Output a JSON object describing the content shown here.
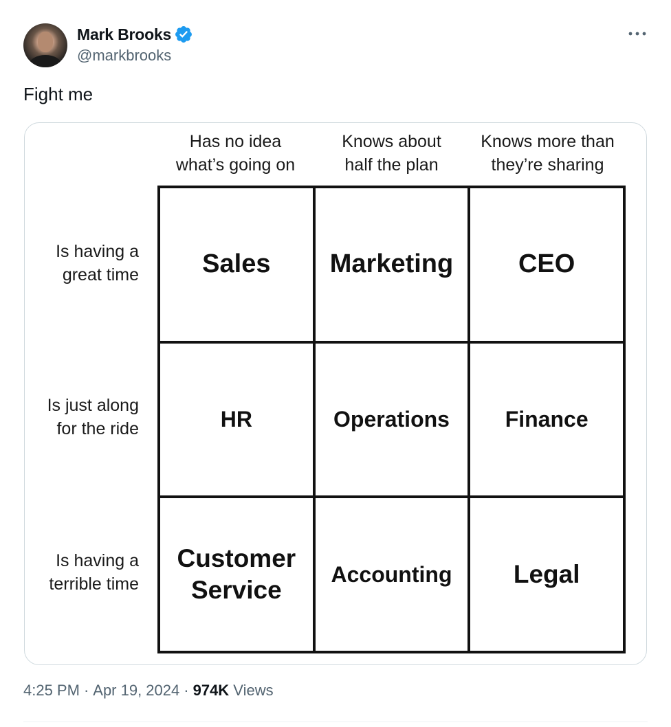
{
  "author": {
    "display_name": "Mark Brooks",
    "handle": "@markbrooks",
    "verified": true,
    "verified_color": "#1d9bf0"
  },
  "tweet": {
    "text": "Fight me"
  },
  "meme": {
    "column_headers": [
      "Has no idea\nwhat’s going on",
      "Knows about\nhalf the plan",
      "Knows more than\nthey’re sharing"
    ],
    "row_headers": [
      "Is having a\ngreat time",
      "Is just along\nfor the ride",
      "Is having a\nterrible time"
    ],
    "cells": [
      [
        "Sales",
        "Marketing",
        "CEO"
      ],
      [
        "HR",
        "Operations",
        "Finance"
      ],
      [
        "Customer\nService",
        "Accounting",
        "Legal"
      ]
    ]
  },
  "meta": {
    "time": "4:25 PM",
    "date": "Apr 19, 2024",
    "views_count": "974K",
    "views_label": "Views",
    "separator": "·"
  }
}
